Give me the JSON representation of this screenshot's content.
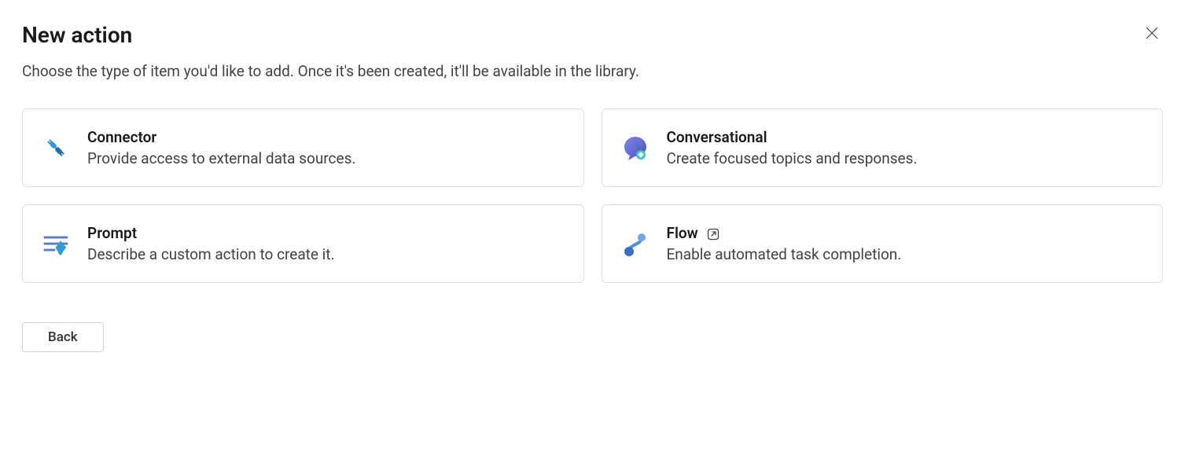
{
  "header": {
    "title": "New action",
    "description": "Choose the type of item you'd like to add. Once it's been created, it'll be available in the library."
  },
  "cards": {
    "connector": {
      "title": "Connector",
      "description": "Provide access to external data sources."
    },
    "conversational": {
      "title": "Conversational",
      "description": "Create focused topics and responses."
    },
    "prompt": {
      "title": "Prompt",
      "description": "Describe a custom action to create it."
    },
    "flow": {
      "title": "Flow",
      "description": "Enable automated task completion."
    }
  },
  "footer": {
    "back_label": "Back"
  }
}
